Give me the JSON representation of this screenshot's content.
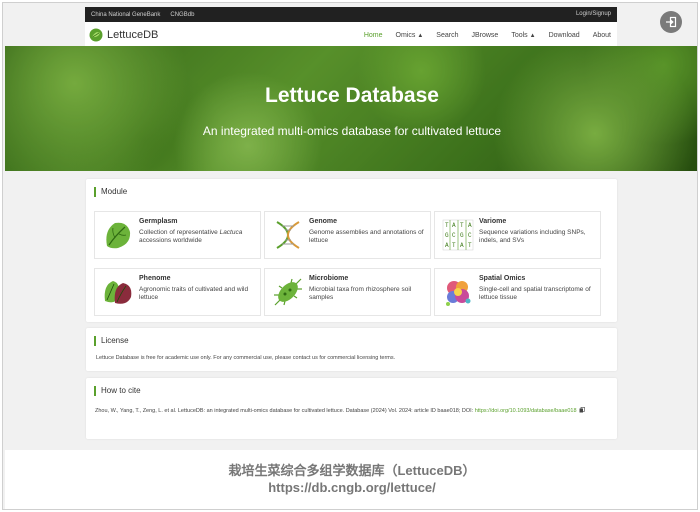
{
  "topbar": {
    "links": [
      "China National GeneBank",
      "CNGBdb"
    ],
    "login": "Login/Signup"
  },
  "icons": {
    "exit": "exit-icon",
    "logo": "lettuce-logo-icon",
    "copy": "copy-icon"
  },
  "brand": {
    "name": "LettuceDB"
  },
  "nav": {
    "home": "Home",
    "omics": "Omics",
    "search": "Search",
    "jbrowse": "JBrowse",
    "tools": "Tools",
    "download": "Download",
    "about": "About"
  },
  "hero": {
    "title": "Lettuce Database",
    "subtitle": "An integrated multi-omics database for cultivated lettuce"
  },
  "module": {
    "heading": "Module",
    "items": [
      {
        "title": "Germplasm",
        "desc_pre": "Collection of representative ",
        "desc_italic": "Lactuca",
        "desc_post": " accessions worldwide",
        "icon": "lettuce-leaf-icon"
      },
      {
        "title": "Genome",
        "desc": "Genome assemblies and annotations of lettuce",
        "icon": "dna-icon"
      },
      {
        "title": "Variome",
        "desc": "Sequence variations including SNPs, indels, and SVs",
        "icon": "sequence-alignment-icon"
      },
      {
        "title": "Phenome",
        "desc": "Agronomic traits of cultivated and wild lettuce",
        "icon": "lettuce-variety-icon"
      },
      {
        "title": "Microbiome",
        "desc": "Microbial taxa from rhizosphere soil samples",
        "icon": "microbe-icon"
      },
      {
        "title": "Spatial Omics",
        "desc": "Single-cell and spatial transcriptome of lettuce tissue",
        "icon": "spatial-cluster-icon"
      }
    ],
    "variome_letters": [
      "T",
      "A",
      "T",
      "A",
      "G",
      "C",
      "G",
      "C",
      "A",
      "T",
      "A",
      "T"
    ]
  },
  "license": {
    "heading": "License",
    "text": "Lettuce Database is free for academic use only. For any commercial use, please contact us for commercial licensing terms."
  },
  "cite": {
    "heading": "How to cite",
    "text": "Zhou, W., Yang, T., Zeng, L. et al. LettuceDB: an integrated multi-omics database for cultivated lettuce. Database (2024) Vol. 2024: article ID baae018; DOI: ",
    "doi": "https://doi.org/10.1093/database/baae018"
  },
  "caption": {
    "cn": "栽培生菜综合多组学数据库（LettuceDB）",
    "url": "https://db.cngb.org/lettuce/"
  }
}
